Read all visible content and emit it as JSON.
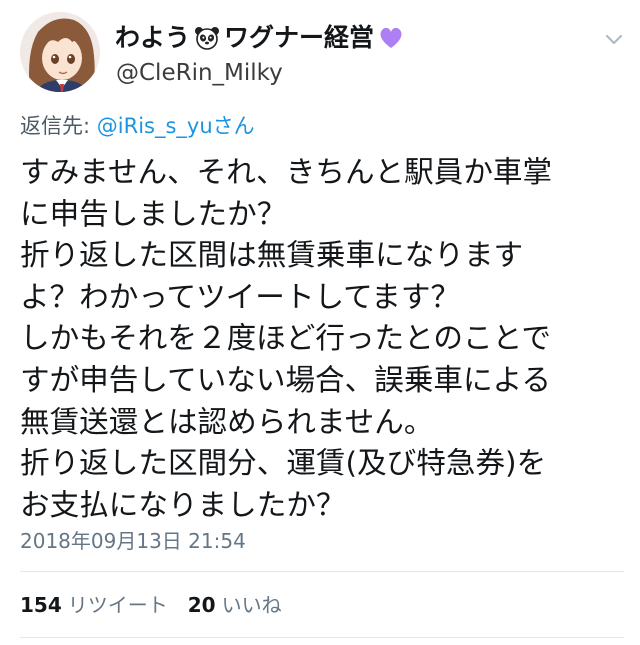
{
  "tweet": {
    "display_name": "わよう",
    "display_name_suffix": "ワグナー経営",
    "handle": "@CleRin_Milky",
    "reply_label": "返信先:",
    "reply_user": "@iRis_s_yu",
    "reply_suffix": "さん",
    "body_lines": [
      "すみません、それ、きちんと駅員か車掌",
      "に申告しましたか？",
      "折り返した区間は無賃乗車になります",
      "よ？わかってツイートしてます？",
      "しかもそれを２度ほど行ったとのことで",
      "すが申告していない場合、誤乗車による",
      "無賃送還とは認められません。",
      "折り返した区間分、運賃(及び特急券)を",
      "お支払になりましたか？"
    ],
    "timestamp": "2018年09月13日 21:54",
    "retweet_count": "154",
    "retweet_label": "リツイート",
    "like_count": "20",
    "like_label": "いいね",
    "icons": {
      "panda": "panda-emoji-icon",
      "heart": "purple-heart-icon",
      "menu": "chevron-down-icon"
    },
    "colors": {
      "link": "#1b95e0",
      "heart": "#ac7ff5",
      "muted": "#657786"
    }
  }
}
